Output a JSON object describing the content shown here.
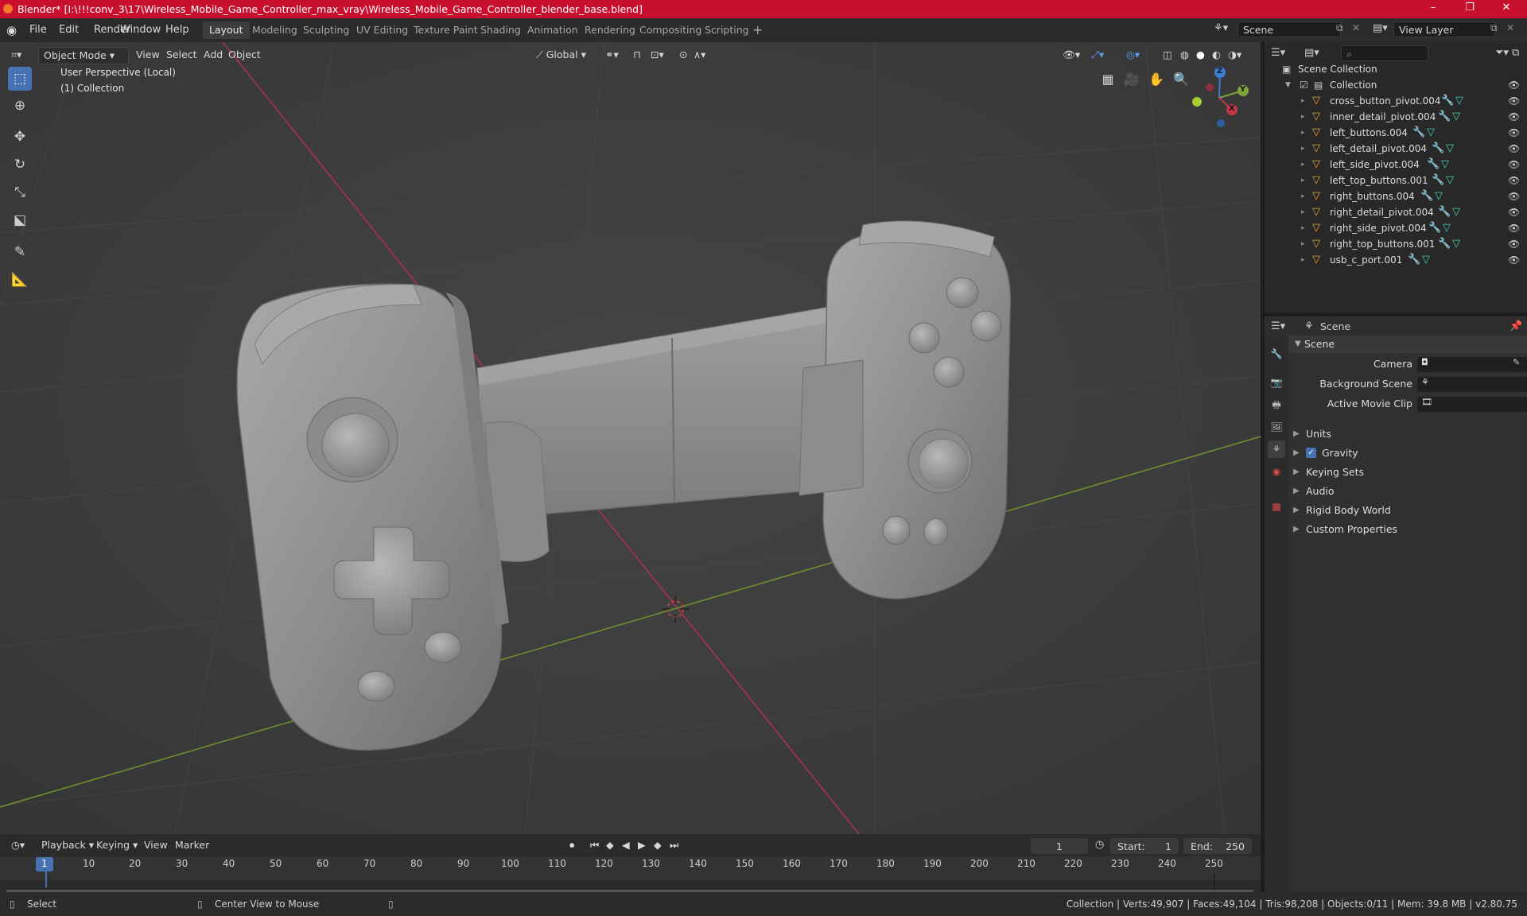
{
  "window": {
    "title": "Blender* [I:\\!!!conv_3\\17\\Wireless_Mobile_Game_Controller_max_vray\\Wireless_Mobile_Game_Controller_blender_base.blend]",
    "minimize": "–",
    "maximize": "❐",
    "close": "✕"
  },
  "menu": {
    "items": [
      "File",
      "Edit",
      "Render",
      "Window",
      "Help"
    ],
    "workspaces": [
      "Layout",
      "Modeling",
      "Sculpting",
      "UV Editing",
      "Texture Paint",
      "Shading",
      "Animation",
      "Rendering",
      "Compositing",
      "Scripting"
    ],
    "active_workspace": "Layout",
    "add_workspace": "+",
    "scene_value": "Scene",
    "view_layer_value": "View Layer"
  },
  "viewport_header": {
    "mode": "Object Mode",
    "menus": [
      "View",
      "Select",
      "Add",
      "Object"
    ],
    "transform_orientation": "Global"
  },
  "viewport": {
    "perspective_label": "User Perspective (Local)",
    "collection_label": "(1) Collection",
    "gizmo_axes": [
      "Z",
      "Y",
      "X"
    ]
  },
  "outliner": {
    "scene_collection": "Scene Collection",
    "collection": "Collection",
    "objects": [
      "cross_button_pivot.004",
      "inner_detail_pivot.004",
      "left_buttons.004",
      "left_detail_pivot.004",
      "left_side_pivot.004",
      "left_top_buttons.001",
      "right_buttons.004",
      "right_detail_pivot.004",
      "right_side_pivot.004",
      "right_top_buttons.001",
      "usb_c_port.001"
    ]
  },
  "properties": {
    "header_title": "Scene",
    "panel_title": "Scene",
    "fields": [
      "Camera",
      "Background Scene",
      "Active Movie Clip"
    ],
    "sections": [
      "Units",
      "Gravity",
      "Keying Sets",
      "Audio",
      "Rigid Body World",
      "Custom Properties"
    ],
    "gravity_checked": true
  },
  "timeline": {
    "menus": [
      "Playback",
      "Keying",
      "View",
      "Marker"
    ],
    "current_frame": "1",
    "start_label": "Start:",
    "start_value": "1",
    "end_label": "End:",
    "end_value": "250",
    "ticks": [
      "1",
      "10",
      "20",
      "30",
      "40",
      "50",
      "60",
      "70",
      "80",
      "90",
      "100",
      "110",
      "120",
      "130",
      "140",
      "150",
      "160",
      "170",
      "180",
      "190",
      "200",
      "210",
      "220",
      "230",
      "240",
      "250"
    ]
  },
  "status_bar": {
    "left_action": "Select",
    "middle_action": "Center View to Mouse",
    "stats": "Collection | Verts:49,907 | Faces:49,104 | Tris:98,208 | Objects:0/11 | Mem: 39.8 MB | v2.80.75"
  },
  "colors": {
    "title_bar": "#c8102e",
    "active_tool": "#4772b3",
    "x_axis": "#c1374a",
    "y_axis": "#7ea43c",
    "z_axis": "#3a7fd6",
    "object_icon": "#f0a13c",
    "mesh_icon": "#3ed2b8",
    "modifier_icon": "#5e9cf0"
  }
}
